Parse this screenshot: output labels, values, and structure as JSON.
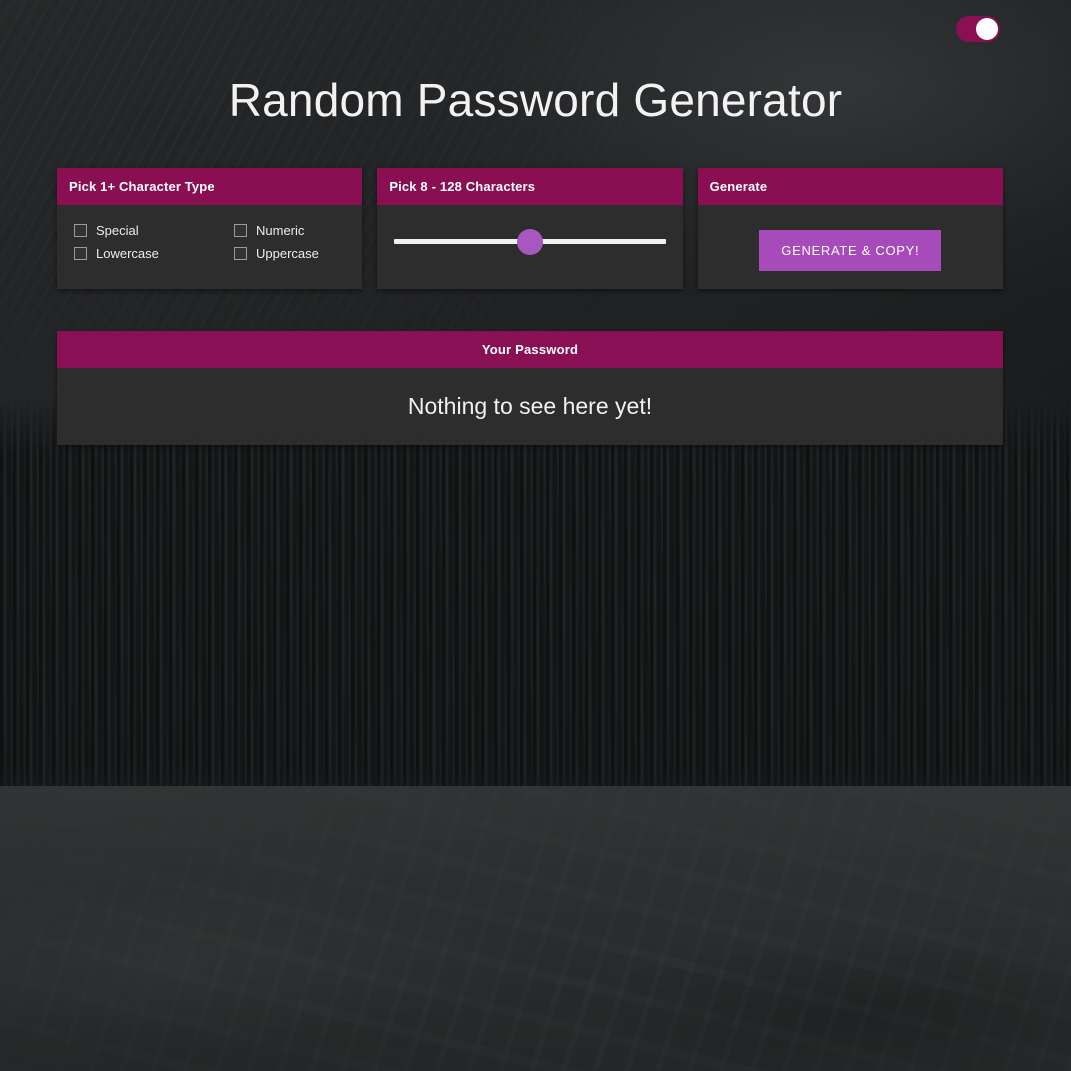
{
  "page": {
    "title": "Random Password Generator"
  },
  "theme_toggle": {
    "name": "theme-toggle",
    "state": "on",
    "track_color": "#8b0f53",
    "knob_color": "#ffffff"
  },
  "colors": {
    "card_header": "#8a0f52",
    "card_body": "#2e2e2e",
    "button": "#a84bba",
    "slider_thumb": "#a857bf",
    "slider_track": "#f0f0f0",
    "text": "#f2f2f2"
  },
  "cards": [
    {
      "header": "Pick 1+ Character Type",
      "checkboxes": [
        {
          "label": "Special",
          "checked": false
        },
        {
          "label": "Numeric",
          "checked": false
        },
        {
          "label": "Lowercase",
          "checked": false
        },
        {
          "label": "Uppercase",
          "checked": false
        }
      ]
    },
    {
      "header": "Pick 8 - 128 Characters",
      "slider": {
        "min": 8,
        "max": 128,
        "value_percent": 50
      }
    },
    {
      "header": "Generate",
      "button_label": "GENERATE & COPY!"
    }
  ],
  "password_panel": {
    "header": "Your Password",
    "message": "Nothing to see here yet!"
  }
}
